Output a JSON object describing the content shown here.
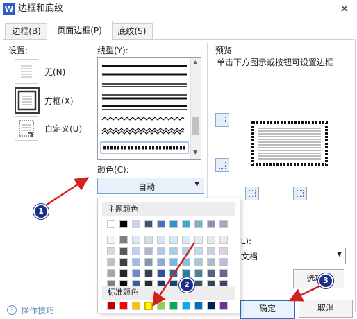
{
  "window": {
    "title": "边框和底纹",
    "app_icon_glyph": "W"
  },
  "tabs": [
    {
      "label": "边框(B)"
    },
    {
      "label": "页面边框(P)",
      "active": true
    },
    {
      "label": "底纹(S)"
    }
  ],
  "settings": {
    "heading": "设置:",
    "items": [
      {
        "label": "无(N)",
        "icon": "none-icon"
      },
      {
        "label": "方框(X)",
        "icon": "box-icon",
        "selected": true
      },
      {
        "label": "自定义(U)",
        "icon": "custom-icon"
      }
    ]
  },
  "line_style": {
    "label": "线型(Y):"
  },
  "color": {
    "label": "颜色(C):",
    "value": "自动"
  },
  "color_popup": {
    "theme_header": "主题颜色",
    "standard_header": "标准颜色",
    "theme_top_row": [
      "#ffffff",
      "#000000",
      "#c5d7f1",
      "#44546a",
      "#4472c4",
      "#2f8fd8",
      "#39a8d8",
      "#7ab0c4",
      "#8496b0",
      "#a9a3bc"
    ],
    "theme_tints": [
      [
        "#f2f2f2",
        "#7f7f7f",
        "#dfe8f7",
        "#d6dce5",
        "#d9e2f3",
        "#d2e7f7",
        "#d4ecf5",
        "#e1edf2",
        "#e4e8ef",
        "#ebe9f0"
      ],
      [
        "#d9d9d9",
        "#595959",
        "#bfd1ef",
        "#adb9ca",
        "#b4c6e7",
        "#a6cfef",
        "#aad8eb",
        "#c3dbe5",
        "#c9d1e0",
        "#d7d3e2"
      ],
      [
        "#bfbfbf",
        "#3f3f3f",
        "#9fbae7",
        "#8497b0",
        "#8eaadb",
        "#79b7e7",
        "#7fc5e0",
        "#a5c9d8",
        "#aeb9d0",
        "#c3bdd4"
      ],
      [
        "#a6a6a6",
        "#262626",
        "#6a8cc8",
        "#333f50",
        "#2f5597",
        "#1f6ca8",
        "#2a7ea2",
        "#4e8196",
        "#506584",
        "#6c6490"
      ],
      [
        "#808080",
        "#0d0d0d",
        "#3a5e9a",
        "#222a35",
        "#1f3864",
        "#154870",
        "#1b546c",
        "#345664",
        "#354458",
        "#484260"
      ]
    ],
    "standard_colors": [
      "#c00000",
      "#ff0000",
      "#ffc000",
      "#ffff00",
      "#92d050",
      "#00b050",
      "#00b0f0",
      "#0070c0",
      "#002060",
      "#7030a0"
    ]
  },
  "preview": {
    "heading": "预览",
    "hint": "单击下方图示或按钮可设置边框"
  },
  "apply_to": {
    "label_partial": "(L):",
    "value_partial": "文档"
  },
  "buttons": {
    "options": "选项...",
    "ok": "确定",
    "cancel": "取消"
  },
  "footer": {
    "tips": "操作技巧"
  },
  "annotations": [
    "1",
    "2",
    "3"
  ],
  "colors": {
    "annotation_arrow": "#d42020",
    "annotation_circle": "#1e2f8a",
    "accent_border": "#7da2ce"
  }
}
